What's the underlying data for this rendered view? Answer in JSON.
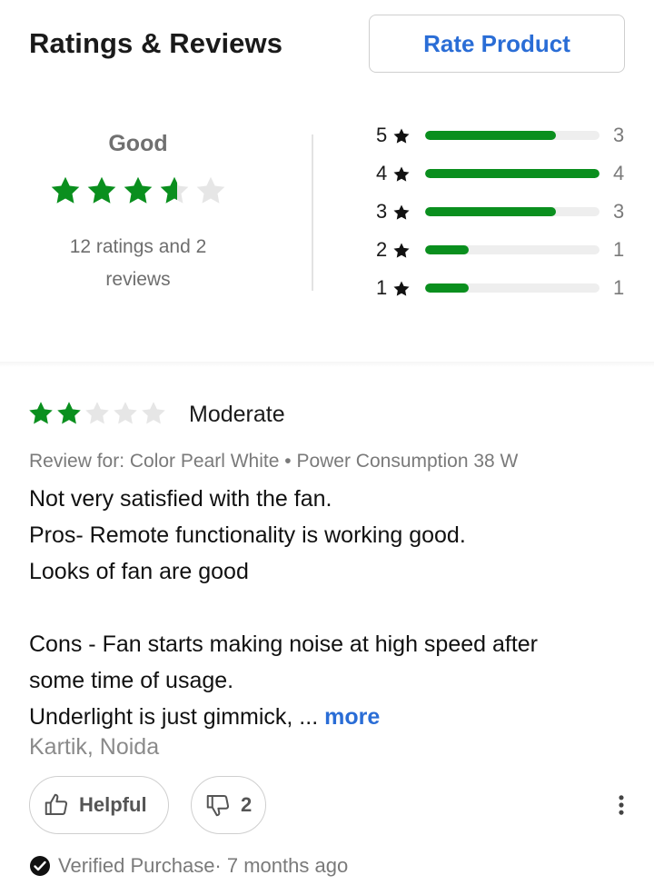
{
  "header": {
    "title": "Ratings & Reviews",
    "rate_button_label": "Rate Product"
  },
  "summary": {
    "overall_label": "Good",
    "overall_rating": 3.6,
    "max_rating": 5,
    "ratings_text": "12 ratings and 2 reviews",
    "distribution": [
      {
        "stars": "5",
        "count": "3",
        "fraction": 0.75
      },
      {
        "stars": "4",
        "count": "4",
        "fraction": 1.0
      },
      {
        "stars": "3",
        "count": "3",
        "fraction": 0.75
      },
      {
        "stars": "2",
        "count": "1",
        "fraction": 0.25
      },
      {
        "stars": "1",
        "count": "1",
        "fraction": 0.25
      }
    ]
  },
  "review": {
    "rating": 2,
    "max_rating": 5,
    "title": "Moderate",
    "variant": "Review for: Color Pearl White • Power Consumption 38 W",
    "body_lines": [
      "Not very satisfied with the fan.",
      "Pros- Remote functionality is working good.",
      "Looks of fan are good",
      "",
      "Cons - Fan starts making noise at high speed after",
      "some time of usage.",
      "Underlight is just gimmick, ... "
    ],
    "more_label": "more",
    "reviewer": "Kartik, Noida",
    "helpful_label": "Helpful",
    "dislike_count": "2",
    "verified_text": "Verified Purchase· 7 months ago"
  },
  "colors": {
    "accent": "#2a6dd6",
    "star_filled": "#0a8f1e",
    "star_empty": "#e6e6e6",
    "bar_fill": "#0a8f1e",
    "bar_track": "#eeeeee"
  },
  "icons": {
    "star": "star-icon",
    "thumbs_up": "thumbs-up-icon",
    "thumbs_down": "thumbs-down-icon",
    "more": "more-vertical-icon",
    "verified": "check-circle-icon"
  }
}
